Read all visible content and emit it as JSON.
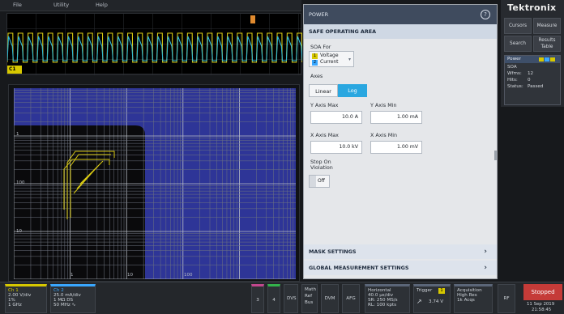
{
  "menubar": {
    "items": [
      "File",
      "Utility",
      "Help"
    ]
  },
  "waveform": {
    "channel_marker": "C1"
  },
  "panel": {
    "title": "POWER",
    "help_icon": "help-circle-icon",
    "section_title": "SAFE OPERATING AREA",
    "soa_for_label": "SOA For",
    "soa_channels": [
      {
        "badge": "1",
        "label": "Voltage",
        "color": "#d7c800"
      },
      {
        "badge": "2",
        "label": "Current",
        "color": "#39a7ff"
      }
    ],
    "axes_label": "Axes",
    "axes_options": [
      "Linear",
      "Log"
    ],
    "axes_selected": "Log",
    "y_axis_max_label": "Y Axis Max",
    "y_axis_max_value": "10.0 A",
    "y_axis_min_label": "Y Axis Min",
    "y_axis_min_value": "1.00 mA",
    "x_axis_max_label": "X Axis Max",
    "x_axis_max_value": "10.0 kV",
    "x_axis_min_label": "X Axis Min",
    "x_axis_min_value": "1.00 mV",
    "stop_on_violation_label": "Stop On\nViolation",
    "stop_on_violation_value": "Off",
    "mask_settings_label": "MASK SETTINGS",
    "global_settings_label": "GLOBAL MEASUREMENT SETTINGS"
  },
  "right_column": {
    "brand": "Tektronix",
    "buttons": [
      "Cursors",
      "Measure",
      "Search",
      "Results\nTable"
    ],
    "badge": {
      "title": "Power",
      "line1": "SOA",
      "wfms_label": "Wfms:",
      "wfms_value": "12",
      "hits_label": "Hits:",
      "hits_value": "0",
      "status_label": "Status:",
      "status_value": "Passed"
    }
  },
  "plot": {
    "y_ticks": [
      "1",
      "100",
      "10"
    ],
    "x_ticks": [
      "1",
      "10",
      "100"
    ]
  },
  "bottom": {
    "ch1": {
      "title": "Ch 1",
      "line1": "2.00 V/div",
      "line2": "1%",
      "line3": "1 GHz",
      "color": "#d7c800"
    },
    "ch2": {
      "title": "Ch 2",
      "line1": "25.0 mA/div",
      "line2": "1 MΩ  DS",
      "line3": "50 MHz ∿",
      "color": "#39a7ff"
    },
    "ch3": "3",
    "ch4": "4",
    "dvs": "DVS",
    "math": {
      "line1": "Math",
      "line2": "Ref",
      "line3": "Bus"
    },
    "dvm": "DVM",
    "afg": "AFG",
    "horizontal": {
      "title": "Horizontal",
      "line1": "40.0 µs/div",
      "line2": "SR: 250 MS/s",
      "line3": "RL: 100 kpts"
    },
    "trigger": {
      "title": "Trigger",
      "badge": "1",
      "value": "3.74 V"
    },
    "acquisition": {
      "title": "Acquisition",
      "line1": "High Res",
      "line2": "1k Acqs"
    },
    "rf": "RF",
    "stopped": "Stopped",
    "date": "11 Sep 2019",
    "time": "21:58:45"
  }
}
